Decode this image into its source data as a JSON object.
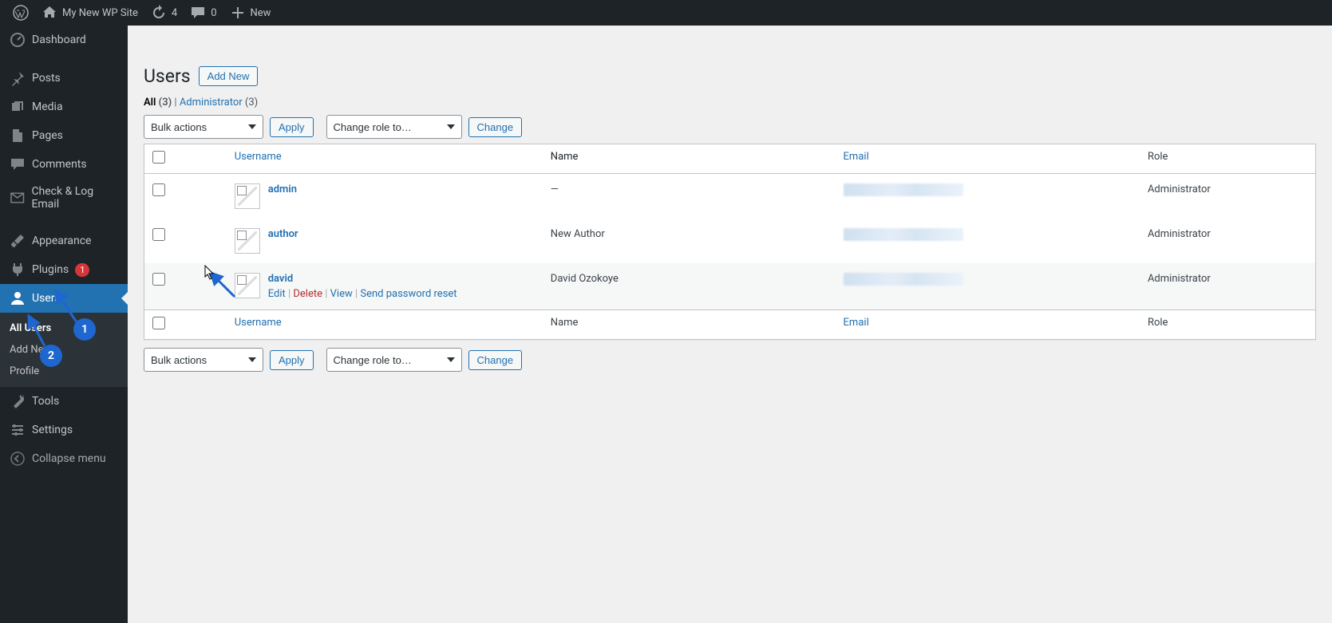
{
  "toolbar": {
    "site_name": "My New WP Site",
    "updates": "4",
    "comments": "0",
    "new": "New"
  },
  "sidebar": {
    "items": [
      {
        "label": "Dashboard"
      },
      {
        "label": "Posts"
      },
      {
        "label": "Media"
      },
      {
        "label": "Pages"
      },
      {
        "label": "Comments"
      },
      {
        "label": "Check & Log Email"
      },
      {
        "label": "Appearance"
      },
      {
        "label": "Plugins",
        "badge": "1"
      },
      {
        "label": "Users"
      },
      {
        "label": "Tools"
      },
      {
        "label": "Settings"
      },
      {
        "label": "Collapse menu"
      }
    ],
    "submenu": [
      {
        "label": "All Users"
      },
      {
        "label": "Add New"
      },
      {
        "label": "Profile"
      }
    ]
  },
  "page": {
    "title": "Users",
    "add_new": "Add New"
  },
  "filters": {
    "all": "All",
    "all_count": "(3)",
    "admin": "Administrator",
    "admin_count": "(3)",
    "sep": " | "
  },
  "actions": {
    "bulk": "Bulk actions",
    "apply": "Apply",
    "change_role": "Change role to…",
    "change": "Change"
  },
  "table": {
    "headers": {
      "username": "Username",
      "name": "Name",
      "email": "Email",
      "role": "Role"
    },
    "rows": [
      {
        "username": "admin",
        "name": "—",
        "role": "Administrator"
      },
      {
        "username": "author",
        "name": "New Author",
        "role": "Administrator"
      },
      {
        "username": "david",
        "name": "David Ozokoye",
        "role": "Administrator",
        "hovered": true
      }
    ],
    "row_actions": {
      "edit": "Edit",
      "delete": "Delete",
      "view": "View",
      "reset": "Send password reset",
      "sep": " | "
    }
  },
  "annotations": {
    "num1": "1",
    "num2": "2"
  }
}
